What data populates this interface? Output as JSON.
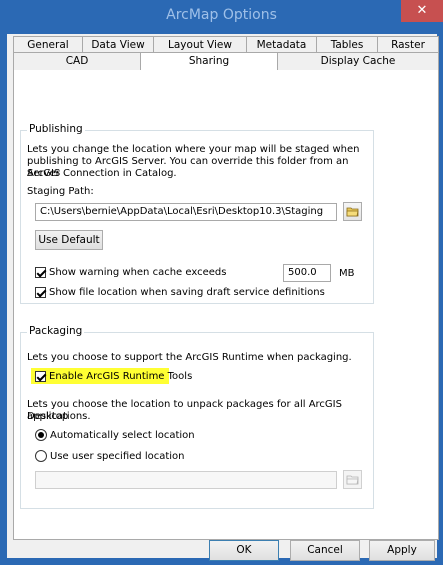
{
  "window": {
    "title": "ArcMap Options",
    "close_glyph": "✕"
  },
  "tabs_row1": [
    "General",
    "Data View",
    "Layout View",
    "Metadata",
    "Tables",
    "Raster"
  ],
  "tabs_row2": [
    "CAD",
    "Sharing",
    "Display Cache"
  ],
  "active_tab": "Sharing",
  "publishing": {
    "legend": "Publishing",
    "description_lines": [
      "Lets you change the location where your map will be staged when",
      "publishing to ArcGIS Server. You can override this folder from an ArcGIS",
      "Server Connection in Catalog."
    ],
    "staging_label": "Staging Path:",
    "staging_path": "C:\\Users\\bernie\\AppData\\Local\\Esri\\Desktop10.3\\Staging",
    "use_default": "Use Default",
    "warn_label": "Show warning when cache exceeds",
    "warn_checked": true,
    "cache_value": "500.0",
    "cache_unit": "MB",
    "file_location_label": "Show file location when saving draft service definitions",
    "file_location_checked": true
  },
  "packaging": {
    "legend": "Packaging",
    "runtime_desc": "Lets you choose to support the ArcGIS Runtime when packaging.",
    "enable_runtime_label": "Enable ArcGIS Runtime Tools",
    "enable_runtime_checked": true,
    "unpack_desc_lines": [
      "Lets you choose the location to unpack packages for all ArcGIS Desktop",
      "applications."
    ],
    "auto_label": "Automatically select location",
    "user_label": "Use user specified location",
    "selected_option": "auto",
    "user_path": ""
  },
  "buttons": {
    "ok": "OK",
    "cancel": "Cancel",
    "apply": "Apply"
  },
  "colors": {
    "titlebar": "#2b69b4",
    "title_text": "#9fc0e8",
    "close": "#c75050",
    "highlight": "#ffff33",
    "folder": "#e8c85a"
  }
}
